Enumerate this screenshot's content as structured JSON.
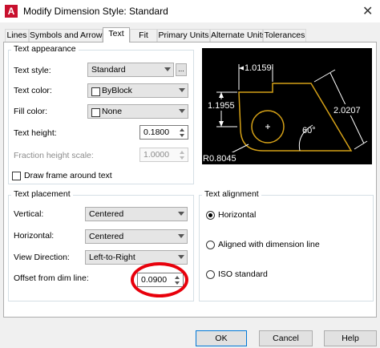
{
  "window": {
    "title": "Modify Dimension Style: Standard",
    "close_glyph": "✕",
    "app_glyph": "A"
  },
  "tabs": [
    {
      "label": "Lines"
    },
    {
      "label": "Symbols and Arrows"
    },
    {
      "label": "Text",
      "active": true
    },
    {
      "label": "Fit"
    },
    {
      "label": "Primary Units"
    },
    {
      "label": "Alternate Units"
    },
    {
      "label": "Tolerances"
    }
  ],
  "text_appearance": {
    "title": "Text appearance",
    "text_style": {
      "label": "Text style:",
      "value": "Standard",
      "browse": "..."
    },
    "text_color": {
      "label": "Text color:",
      "value": "ByBlock"
    },
    "fill_color": {
      "label": "Fill color:",
      "value": "None"
    },
    "text_height": {
      "label": "Text height:",
      "value": "0.1800"
    },
    "fraction_height": {
      "label": "Fraction height scale:",
      "value": "1.0000",
      "disabled": true
    },
    "draw_frame": {
      "label": "Draw frame around text",
      "checked": false
    }
  },
  "text_placement": {
    "title": "Text placement",
    "vertical": {
      "label": "Vertical:",
      "value": "Centered"
    },
    "horizontal": {
      "label": "Horizontal:",
      "value": "Centered"
    },
    "view_direction": {
      "label": "View Direction:",
      "value": "Left-to-Right"
    },
    "offset": {
      "label": "Offset from dim line:",
      "value": "0.0900"
    }
  },
  "text_alignment": {
    "title": "Text alignment",
    "options": [
      {
        "label": "Horizontal",
        "selected": true
      },
      {
        "label": "Aligned with dimension line",
        "selected": false
      },
      {
        "label": "ISO standard",
        "selected": false
      }
    ]
  },
  "preview": {
    "dim_top": "1.0159",
    "dim_left": "1.1955",
    "dim_right": "2.0207",
    "angle": "60°",
    "radius": "R0.8045",
    "colors": {
      "geometry": "#d4a017",
      "dimensions": "#ffffff",
      "background": "#000000"
    }
  },
  "buttons": {
    "ok": "OK",
    "cancel": "Cancel",
    "help": "Help"
  },
  "annotation": {
    "highlight_color": "#e8000b"
  }
}
